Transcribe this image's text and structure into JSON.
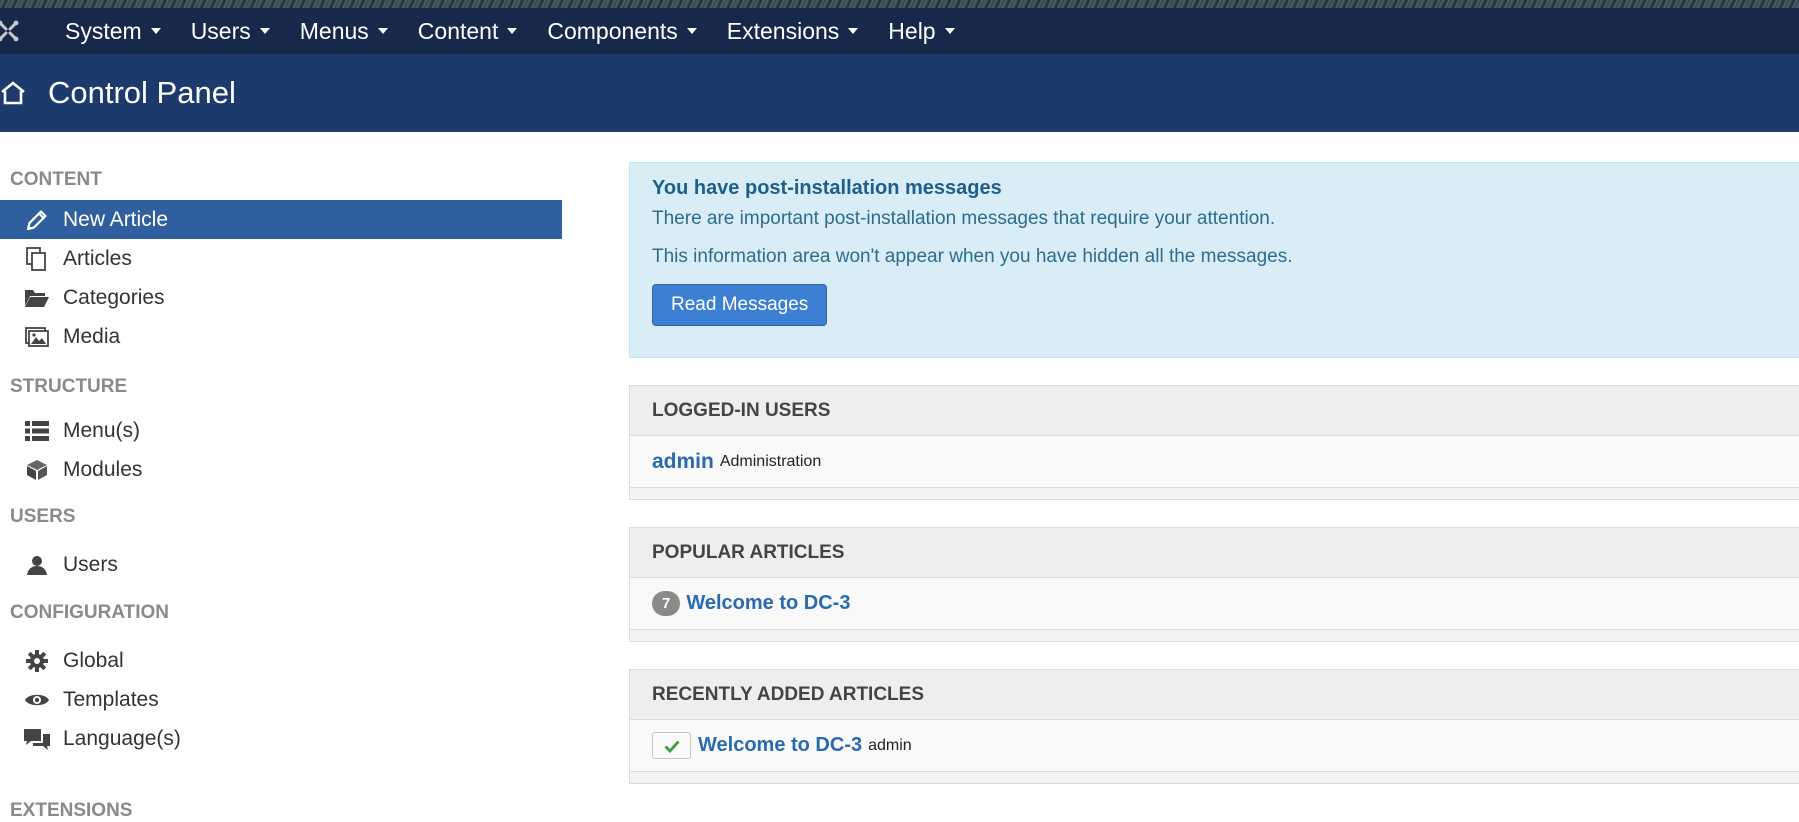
{
  "nav": {
    "brand_icon": "joomla-icon",
    "items": [
      {
        "label": "System"
      },
      {
        "label": "Users"
      },
      {
        "label": "Menus"
      },
      {
        "label": "Content"
      },
      {
        "label": "Components"
      },
      {
        "label": "Extensions"
      },
      {
        "label": "Help"
      }
    ]
  },
  "page": {
    "title": "Control Panel",
    "title_icon": "home-icon"
  },
  "sidebar": {
    "content": {
      "heading": "CONTENT",
      "items": [
        {
          "label": "New Article",
          "icon": "pencil-icon",
          "active": true
        },
        {
          "label": "Articles",
          "icon": "copy-icon"
        },
        {
          "label": "Categories",
          "icon": "folder-open-icon"
        },
        {
          "label": "Media",
          "icon": "image-icon"
        }
      ]
    },
    "structure": {
      "heading": "STRUCTURE",
      "items": [
        {
          "label": "Menu(s)",
          "icon": "list-icon"
        },
        {
          "label": "Modules",
          "icon": "cube-icon"
        }
      ]
    },
    "users": {
      "heading": "USERS",
      "items": [
        {
          "label": "Users",
          "icon": "user-icon"
        }
      ]
    },
    "configuration": {
      "heading": "CONFIGURATION",
      "items": [
        {
          "label": "Global",
          "icon": "gear-icon"
        },
        {
          "label": "Templates",
          "icon": "eye-icon"
        },
        {
          "label": "Language(s)",
          "icon": "comments-icon"
        }
      ]
    },
    "extensions_heading": "EXTENSIONS"
  },
  "alert": {
    "title": "You have post-installation messages",
    "line1": "There are important post-installation messages that require your attention.",
    "line2": "This information area won't appear when you have hidden all the messages.",
    "button": "Read Messages"
  },
  "modules": {
    "logged_in": {
      "title": "LOGGED-IN USERS",
      "user": "admin",
      "role": "Administration"
    },
    "popular": {
      "title": "POPULAR ARTICLES",
      "hits": "7",
      "article": "Welcome to DC-3"
    },
    "recent": {
      "title": "RECENTLY ADDED ARTICLES",
      "article": "Welcome to DC-3",
      "author": "admin",
      "status_icon": "check-icon"
    }
  },
  "colors": {
    "topnav": "#17284a",
    "titlebar": "#1c3a6b",
    "active_item": "#2f5f9e",
    "alert_bg": "#d9edf7",
    "link": "#2a6ab0",
    "button": "#3c7fd3"
  }
}
